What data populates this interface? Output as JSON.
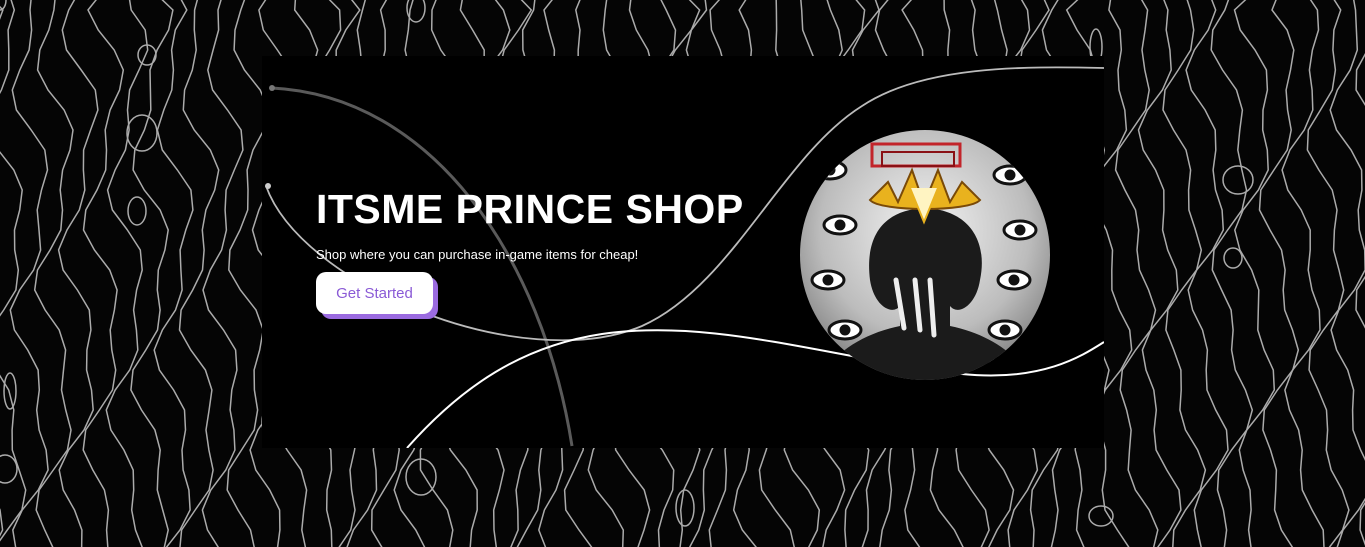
{
  "hero": {
    "title": "ITSME PRINCE SHOP",
    "subtitle": "Shop where you can purchase in-game items for cheap!",
    "cta_label": "Get Started"
  },
  "colors": {
    "background": "#000000",
    "pattern_lines": "#bdbdbd",
    "accent": "#9b6be0",
    "button_text": "#8a5ad6",
    "text": "#ffffff"
  },
  "avatar": {
    "icon": "anime-character-with-halo-icon"
  }
}
